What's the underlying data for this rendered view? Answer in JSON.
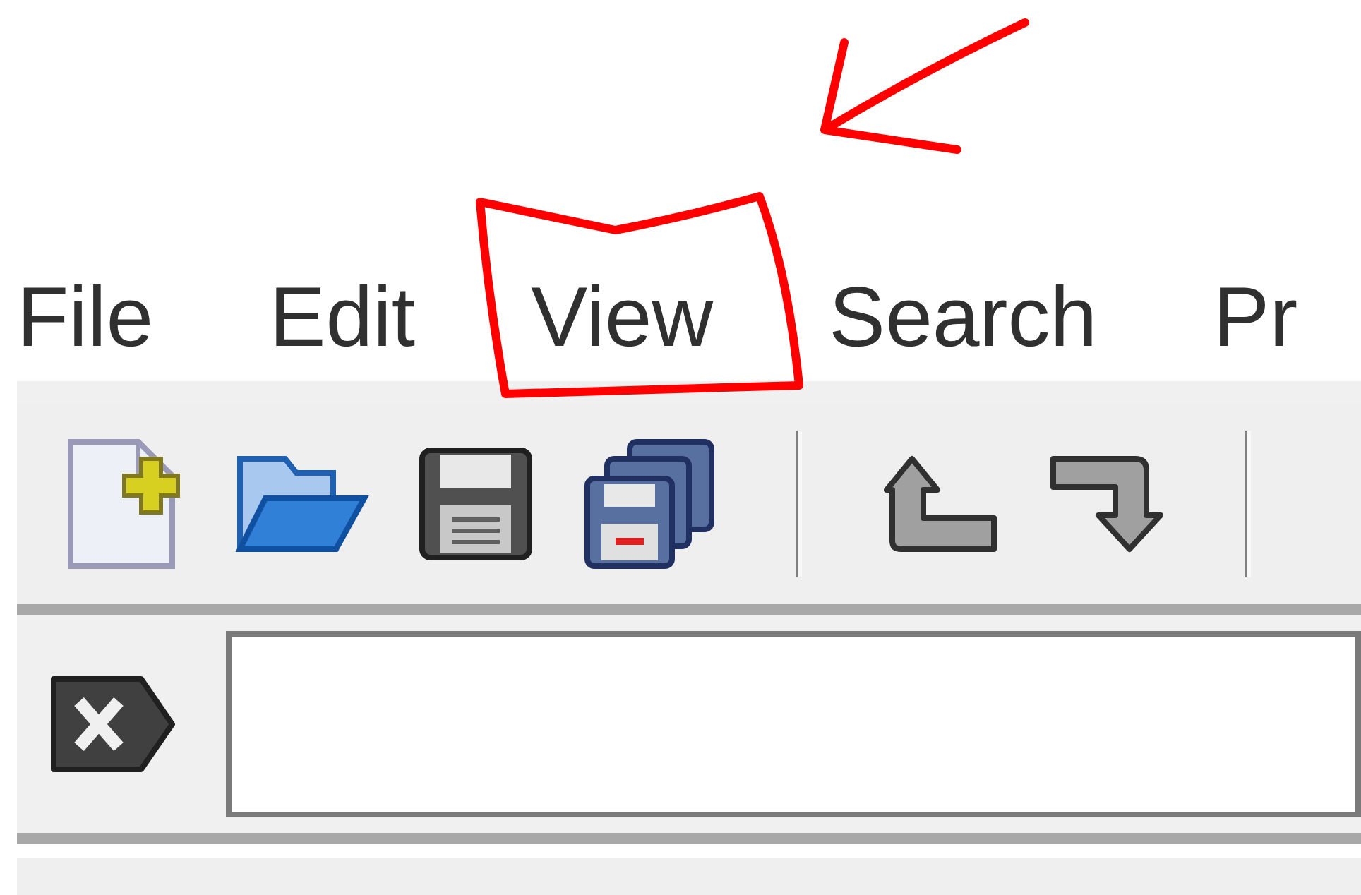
{
  "menu_bar": {
    "items": [
      {
        "label": "File",
        "circled": false
      },
      {
        "label": "Edit",
        "circled": false
      },
      {
        "label": "View",
        "circled": true
      },
      {
        "label": "Search",
        "circled": false
      },
      {
        "label": "Pr",
        "circled": false
      }
    ]
  }
}
